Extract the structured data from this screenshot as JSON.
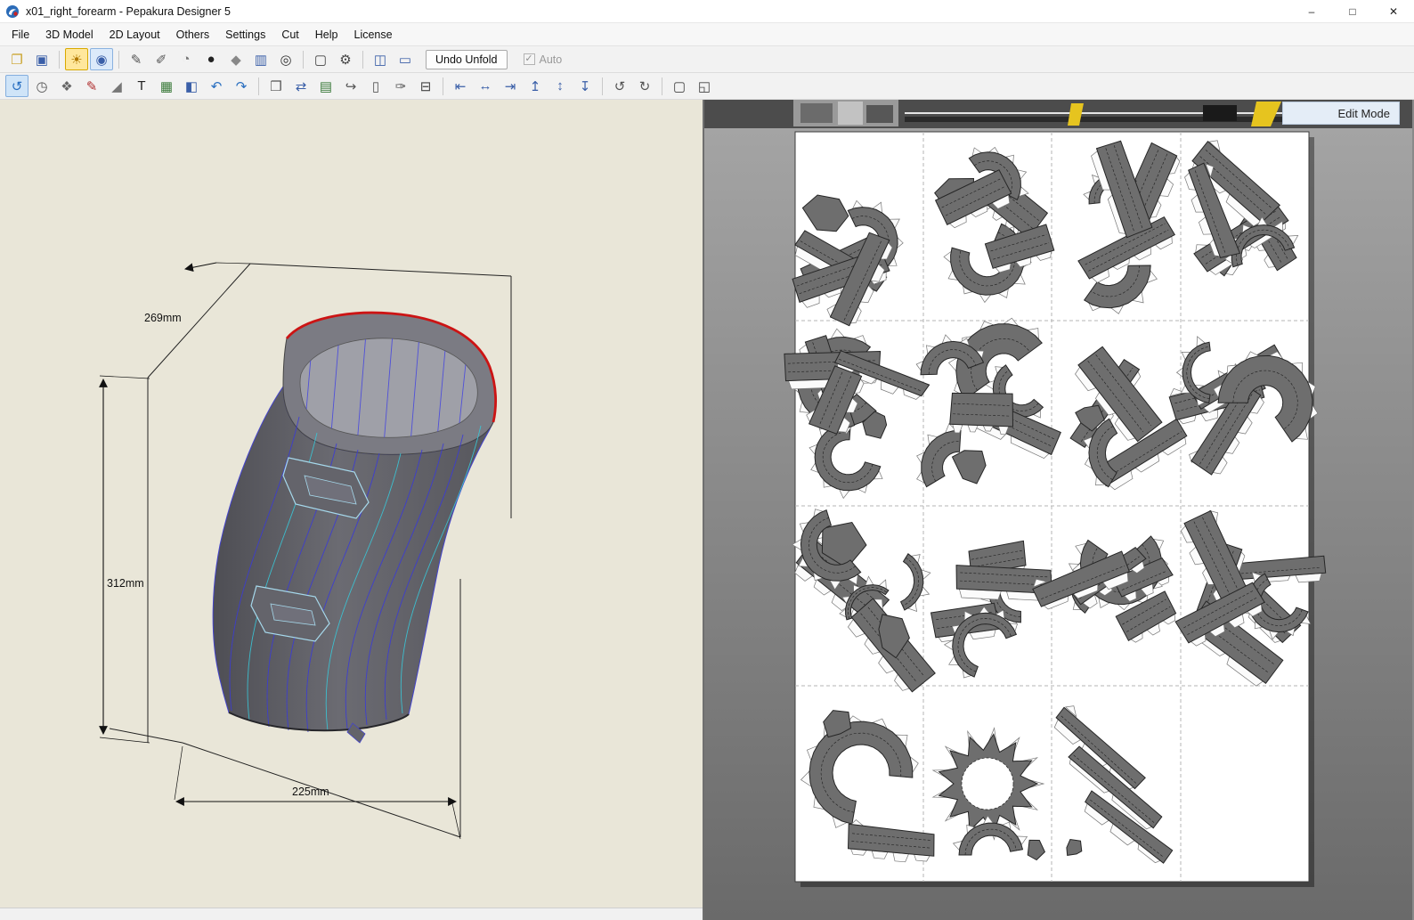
{
  "window": {
    "title": "x01_right_forearm - Pepakura Designer 5",
    "controls": {
      "minimize": "–",
      "maximize": "□",
      "close": "✕"
    }
  },
  "menu": {
    "items": [
      {
        "label": "File"
      },
      {
        "label": "3D Model"
      },
      {
        "label": "2D Layout"
      },
      {
        "label": "Others"
      },
      {
        "label": "Settings"
      },
      {
        "label": "Cut"
      },
      {
        "label": "Help"
      },
      {
        "label": "License"
      }
    ]
  },
  "toolbar_top": {
    "icons": [
      {
        "name": "open-file-icon",
        "glyph": "❐",
        "color": "#c9a227"
      },
      {
        "name": "save-icon",
        "glyph": "▣",
        "color": "#3a5fa8"
      },
      {
        "sep": true
      },
      {
        "name": "light-toggle-icon",
        "glyph": "☀",
        "color": "#b07800",
        "active": true,
        "active_bg": "#ffe79c",
        "active_border": "#d9a900"
      },
      {
        "name": "texture-view-icon",
        "glyph": "◉",
        "color": "#3a5fa8",
        "active": true,
        "active_bg": "#dceafa",
        "active_border": "#8ab2e0"
      },
      {
        "sep": true
      },
      {
        "name": "paint-sphere-icon",
        "glyph": "✎",
        "color": "#555555"
      },
      {
        "name": "paint-arrow-icon",
        "glyph": "✐",
        "color": "#555555"
      },
      {
        "name": "pour-color-icon",
        "glyph": "◔",
        "color": "#777777"
      },
      {
        "name": "dark-sphere-icon",
        "glyph": "●",
        "color": "#222222"
      },
      {
        "name": "plumb-icon",
        "glyph": "◆",
        "color": "#888888"
      },
      {
        "name": "columns-icon",
        "glyph": "▥",
        "color": "#3a5fa8"
      },
      {
        "name": "zoom-sphere-icon",
        "glyph": "◎",
        "color": "#333333"
      },
      {
        "sep": true
      },
      {
        "name": "selection-area-icon",
        "glyph": "▢",
        "color": "#444444"
      },
      {
        "name": "selection-config-icon",
        "glyph": "⚙",
        "color": "#444444"
      },
      {
        "sep": true
      },
      {
        "name": "split-view-icon",
        "glyph": "◫",
        "color": "#3a5fa8"
      },
      {
        "name": "single-view-icon",
        "glyph": "▭",
        "color": "#3a5fa8"
      }
    ],
    "undo_unfold_label": "Undo Unfold",
    "auto_label": "Auto",
    "auto_check_glyph": "✓"
  },
  "toolbar_edit": {
    "icons": [
      {
        "name": "orbit-icon",
        "glyph": "↺",
        "color": "#2a6fc0",
        "active": true,
        "active_bg": "#cfe4f8",
        "active_border": "#84aede"
      },
      {
        "name": "measure-icon",
        "glyph": "◷",
        "color": "#555555"
      },
      {
        "name": "unfold-parts-icon",
        "glyph": "❖",
        "color": "#666666"
      },
      {
        "name": "edge-color-icon",
        "glyph": "✎",
        "color": "#b03030"
      },
      {
        "name": "flap-icon",
        "glyph": "◢",
        "color": "#777777"
      },
      {
        "name": "text-icon",
        "glyph": "T",
        "color": "#222222"
      },
      {
        "name": "image-icon",
        "glyph": "▦",
        "color": "#3a7a3a"
      },
      {
        "name": "box-3d-icon",
        "glyph": "◧",
        "color": "#3a5fa8"
      },
      {
        "name": "undo-icon",
        "glyph": "↶",
        "color": "#2a6fc0"
      },
      {
        "name": "redo-icon",
        "glyph": "↷",
        "color": "#2a6fc0"
      },
      {
        "sep": true
      },
      {
        "name": "book-icon",
        "glyph": "❒",
        "color": "#555555"
      },
      {
        "name": "book-sync-icon",
        "glyph": "⇄",
        "color": "#3a5fa8"
      },
      {
        "name": "layout-chart-icon",
        "glyph": "▤",
        "color": "#3a7a3a"
      },
      {
        "name": "page-export-icon",
        "glyph": "↪",
        "color": "#555555"
      },
      {
        "name": "page-icon",
        "glyph": "▯",
        "color": "#555555"
      },
      {
        "name": "page-edit-icon",
        "glyph": "✑",
        "color": "#555555"
      },
      {
        "name": "print-icon",
        "glyph": "⊟",
        "color": "#444444"
      },
      {
        "sep": true
      },
      {
        "name": "align-left-icon",
        "glyph": "⇤",
        "color": "#3a5fa8"
      },
      {
        "name": "align-center-h-icon",
        "glyph": "↔",
        "color": "#3a5fa8"
      },
      {
        "name": "align-right-icon",
        "glyph": "⇥",
        "color": "#3a5fa8"
      },
      {
        "name": "align-top-icon",
        "glyph": "↥",
        "color": "#3a5fa8"
      },
      {
        "name": "align-middle-icon",
        "glyph": "↕",
        "color": "#3a5fa8"
      },
      {
        "name": "align-bottom-icon",
        "glyph": "↧",
        "color": "#3a5fa8"
      },
      {
        "sep": true
      },
      {
        "name": "rotate-ccw-icon",
        "glyph": "↺",
        "color": "#555555"
      },
      {
        "name": "rotate-cw-icon",
        "glyph": "↻",
        "color": "#555555"
      },
      {
        "sep": true
      },
      {
        "name": "frame-select-icon",
        "glyph": "▢",
        "color": "#444444"
      },
      {
        "name": "frame-expand-icon",
        "glyph": "◱",
        "color": "#444444"
      }
    ]
  },
  "viewport_3d": {
    "depth_label": "269mm",
    "height_label": "312mm",
    "width_label": "225mm"
  },
  "viewport_2d": {
    "edit_mode_label": "Edit Mode"
  }
}
